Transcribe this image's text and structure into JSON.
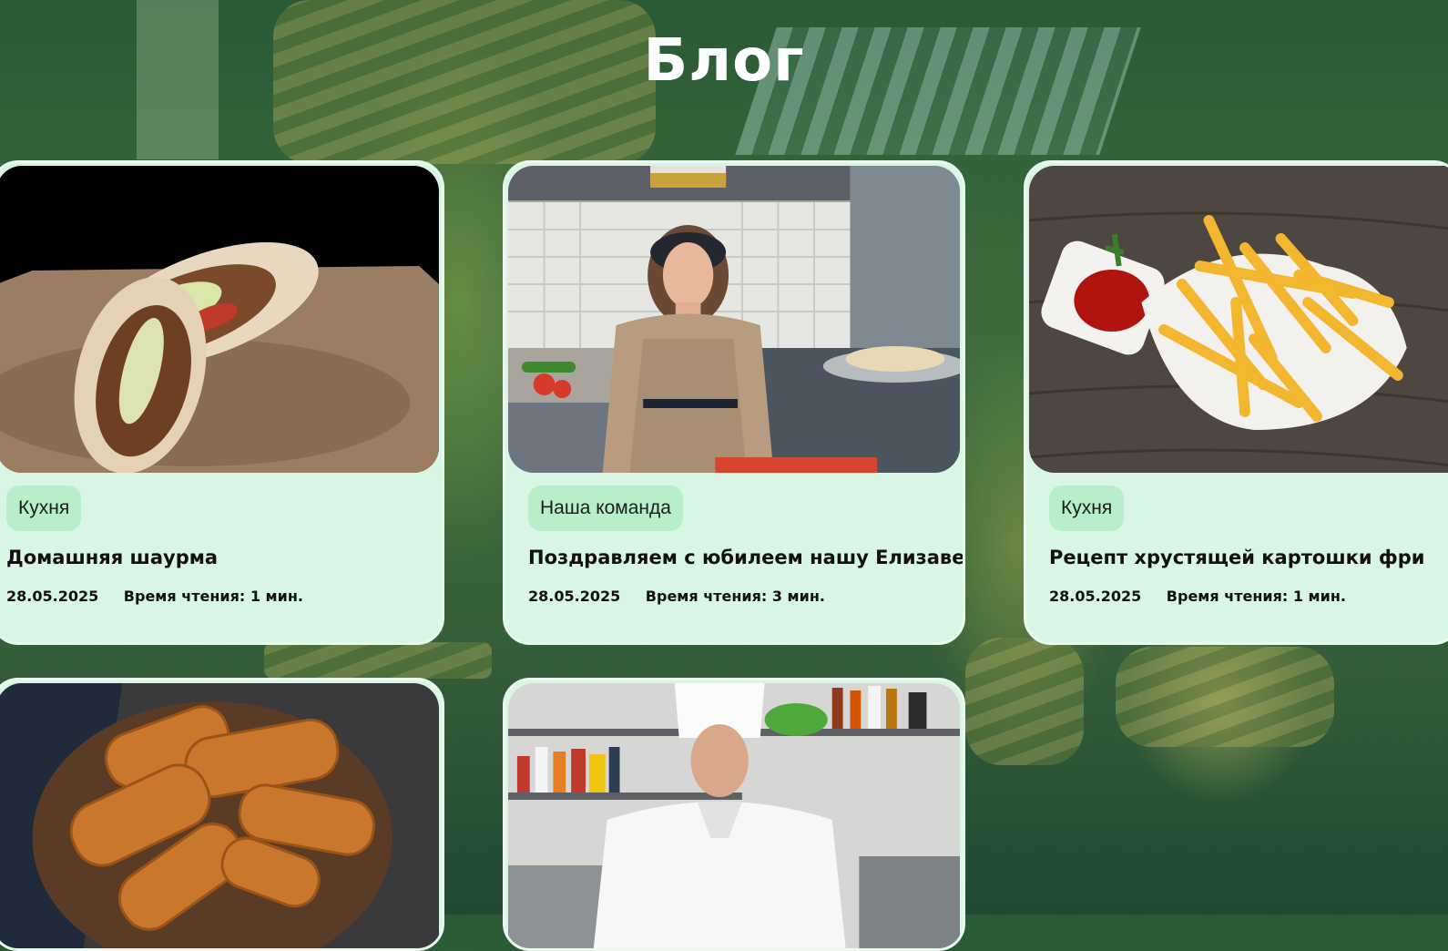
{
  "page": {
    "title": "Блог"
  },
  "posts": [
    {
      "tag": "Кухня",
      "title": "Домашняя шаурма",
      "date": "28.05.2025",
      "read_time": "Время чтения: 1 мин."
    },
    {
      "tag": "Наша команда",
      "title": "Поздравляем с юбилеем нашу Елизавету!",
      "date": "28.05.2025",
      "read_time": "Время чтения: 3 мин."
    },
    {
      "tag": "Кухня",
      "title": "Рецепт хрустящей картошки фри",
      "date": "28.05.2025",
      "read_time": "Время чтения: 1 мин."
    }
  ],
  "colors": {
    "card_bg": "#d9f6e4",
    "tag_bg": "#b8efcb",
    "title_color": "#ffffff"
  }
}
